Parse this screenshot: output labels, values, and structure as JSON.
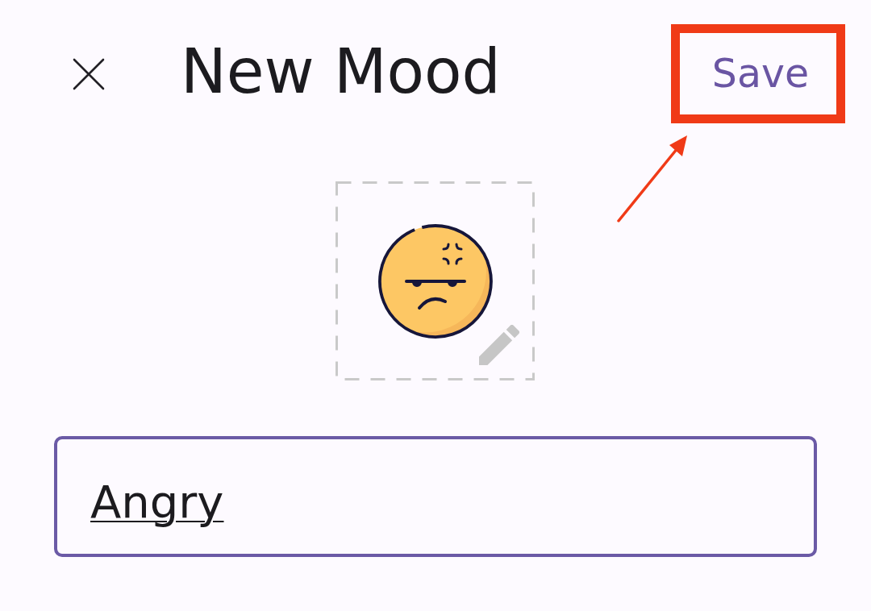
{
  "top_bar": {
    "title": "New Mood",
    "save_button": {
      "label": "Save",
      "highlighted": true
    }
  },
  "name_field": {
    "value": "Angry"
  }
}
